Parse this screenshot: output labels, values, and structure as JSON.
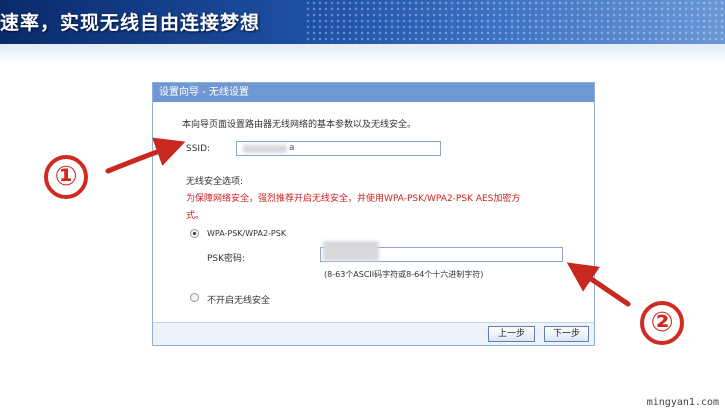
{
  "banner": {
    "title": "速率，实现无线自由连接梦想"
  },
  "dialog": {
    "header": "设置向导 - 无线设置",
    "intro": "本向导页面设置路由器无线网络的基本参数以及无线安全。",
    "ssid_label": "SSID:",
    "ssid_value": "a",
    "security_options_label": "无线安全选项:",
    "security_warning_line1": "为保障网络安全，强烈推荐开启无线安全，并使用WPA-PSK/WPA2-PSK AES加密方",
    "security_warning_line2": "式。",
    "option_wpa_label": "WPA-PSK/WPA2-PSK",
    "psk_label": "PSK密码:",
    "psk_value": "",
    "psk_hint": "(8-63个ASCII码字符或8-64个十六进制字符)",
    "option_none_label": "不开启无线安全",
    "btn_prev": "上一步",
    "btn_next": "下一步"
  },
  "annotations": {
    "marker1": "①",
    "marker2": "②"
  },
  "watermark": "mingyan1.com",
  "colors": {
    "accent_red": "#cc2222",
    "header_blue": "#6f98d2"
  }
}
